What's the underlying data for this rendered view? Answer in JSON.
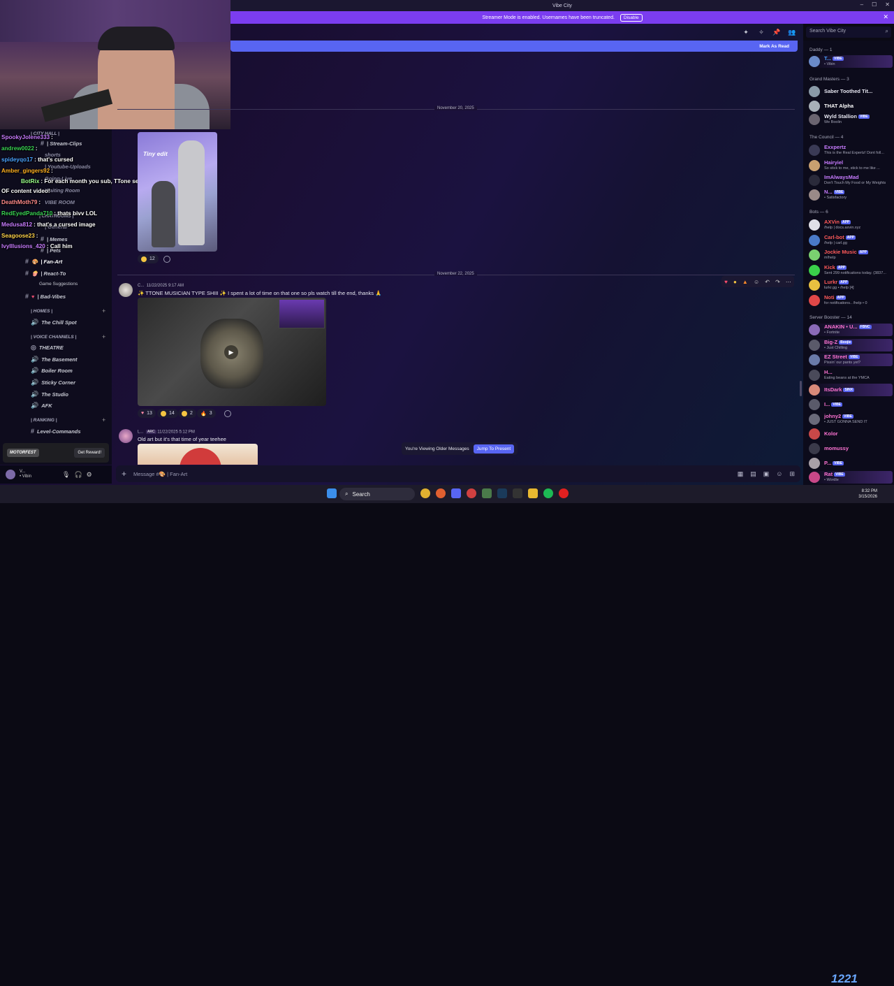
{
  "window": {
    "title": "Vibe City"
  },
  "banner": {
    "text": "Streamer Mode is enabled. Usernames have been truncated.",
    "button": "Disable"
  },
  "search": {
    "placeholder": "Search Vibe City"
  },
  "new_messages_bar": {
    "label": "Mark As Read"
  },
  "dates": [
    "November 20, 2025",
    "November 22, 2025"
  ],
  "image1_caption": "Tiny edit",
  "reactions1": [
    {
      "count": "12"
    }
  ],
  "message2": {
    "author": "C...",
    "time": "11/22/2025 9:17 AM",
    "text": "✨ TTONE MUSICIAN TYPE SHIII ✨ I spent a lot of time on that one so pls watch till the end, thanks 🙏"
  },
  "reactions2": [
    {
      "count": "13"
    },
    {
      "count": "14"
    },
    {
      "count": "2"
    },
    {
      "count": "3"
    }
  ],
  "message3": {
    "author": "L...",
    "badge": "ARC",
    "time": "11/22/2025 5:12 PM",
    "text": "Old art but it's that time of year teehee"
  },
  "older": {
    "text": "You're Viewing Older Messages",
    "button": "Jump To Present"
  },
  "composer": {
    "placeholder": "Message #🎨 | Fan-Art"
  },
  "channels": {
    "cat_city_hall": "| CITY HALL |",
    "stream_clips": "| Stream-Clips",
    "shorts": "shorts",
    "youtube_uploads": "| Youtube-Uploads",
    "going_live": "Going-Live",
    "waiting_room": "Waiting Room",
    "vibe_room": "VIBE ROOM",
    "chatrooms": "| CHATROOMS |",
    "general": "| General",
    "memes": "| Memes",
    "pets": "| Pets",
    "fan_art": "| Fan-Art",
    "react_to": "| React-To",
    "game_suggestions": "Game Suggestions",
    "bad_vibes": "| Bad-Vibes",
    "cat_homes": "| HOMES |",
    "chill_spot": "The Chill Spot",
    "cat_voice": "| VOICE CHANNELS |",
    "theatre": "THEATRE",
    "basement": "The Basement",
    "boiler_room": "Boiler Room",
    "sticky_corner": "Sticky Corner",
    "studio": "The Studio",
    "afk": "AFK",
    "cat_ranking": "| RANKING |",
    "level_commands": "Level-Commands"
  },
  "stream_chat": [
    {
      "user": "SpookyJolene333",
      "text": ":",
      "color": "#c87cff"
    },
    {
      "user": "andrew0022",
      "text": ":",
      "color": "#39d353"
    },
    {
      "user": "spideyqo17",
      "text": ": that's cursed",
      "color": "#4aa3ff"
    },
    {
      "user": "Amber_gingers92",
      "text": ":",
      "color": "#ffb020"
    },
    {
      "user": "BotRix",
      "text": ": For each month you sub, TTone sends you a personal",
      "color": "#9aff8a"
    },
    {
      "user": "",
      "text": "OF content video!",
      "color": "#ffffff"
    },
    {
      "user": "DeathMoth79",
      "text": ":",
      "color": "#ff8a8a"
    },
    {
      "user": "RedEyedPanda710",
      "text": ": thats bivv LOL",
      "color": "#39d353"
    },
    {
      "user": "Medusa812",
      "text": ": that's a cursed image",
      "color": "#c87cff"
    },
    {
      "user": "Seagoose23",
      "text": ":",
      "color": "#ffd24a"
    },
    {
      "user": "IvyIllusions_420",
      "text": ": Call him",
      "color": "#c87cff"
    }
  ],
  "promo": {
    "brand": "MOTORFEST",
    "button": "Get Reward!"
  },
  "user": {
    "name": "V...",
    "status": "• Vibin"
  },
  "members": {
    "groups": [
      {
        "title": "Daddy — 1"
      },
      {
        "title": "Grand Masters — 3"
      },
      {
        "title": "The Council — 4"
      },
      {
        "title": "Bots — 6"
      },
      {
        "title": "Server Booster — 14"
      }
    ],
    "list": [
      {
        "name": "T...",
        "status": "• Vibin",
        "color": "#4aa3ff"
      },
      {
        "name": "Saber Toothed Tit...",
        "status": "",
        "color": "#e6e6f0"
      },
      {
        "name": "THAT Alpha",
        "status": "",
        "color": "#ffffff"
      },
      {
        "name": "Wyld Stallion",
        "status": "We Boolin",
        "color": "#e6e6f0"
      },
      {
        "name": "Exxpertz",
        "status": "This is the Real Expertz! Dont foll...",
        "color": "#c87cff"
      },
      {
        "name": "Hairyiel",
        "status": "So stick to me, stick to me like ...",
        "color": "#c87cff"
      },
      {
        "name": "ImAlwaysMad",
        "status": "Don't Touch My Food or My Weights",
        "color": "#c87cff"
      },
      {
        "name": "N...",
        "status": "• Satisfactory",
        "color": "#c87cff"
      },
      {
        "name": "AXVin",
        "status": "/help | docs.axvin.xyz",
        "color": "#ff5a5a"
      },
      {
        "name": "Carl-bot",
        "status": "/help | carl.gg",
        "color": "#ff5a5a"
      },
      {
        "name": "Jockie Music",
        "status": "m!help",
        "color": "#ff5a5a"
      },
      {
        "name": "Kick",
        "status": "Sent 299 notifications today. (3837...",
        "color": "#ff5a5a"
      },
      {
        "name": "Lurkr",
        "status": "lurkr.gg • /help [4]",
        "color": "#ff5a5a"
      },
      {
        "name": "Noti",
        "status": "for notifications.. /help • 0",
        "color": "#ff5a5a"
      },
      {
        "name": "ANAKIN • U...",
        "status": "• Fortnite",
        "color": "#ff74d4"
      },
      {
        "name": "Big-Z",
        "status": "• Just Chilling",
        "color": "#ff74d4"
      },
      {
        "name": "EZ Street",
        "status": "Pissin' our pants yet?",
        "color": "#ff74d4"
      },
      {
        "name": "H...",
        "status": "Eating beans at the YMCA",
        "color": "#ff74d4"
      },
      {
        "name": "ItsDark",
        "status": "",
        "color": "#ff74d4"
      },
      {
        "name": "I...",
        "status": "",
        "color": "#ff74d4"
      },
      {
        "name": "johny2",
        "status": "• JUST GONNA SEND IT",
        "color": "#ff74d4"
      },
      {
        "name": "Kolor",
        "status": "",
        "color": "#ff74d4"
      },
      {
        "name": "momussy",
        "status": "",
        "color": "#ff74d4"
      },
      {
        "name": "P...",
        "status": "",
        "color": "#ff74d4"
      },
      {
        "name": "Rat",
        "status": "• Wordle",
        "color": "#ff74d4"
      }
    ],
    "tags": {
      "vibe": "VIBE",
      "app": "APP",
      "fbnc": "FBNC",
      "boojie": "Boojie",
      "sinx": "SINX"
    }
  },
  "taskbar": {
    "search": "Search",
    "time": "8:32 PM",
    "date": "3/15/2026",
    "big": "1221"
  }
}
